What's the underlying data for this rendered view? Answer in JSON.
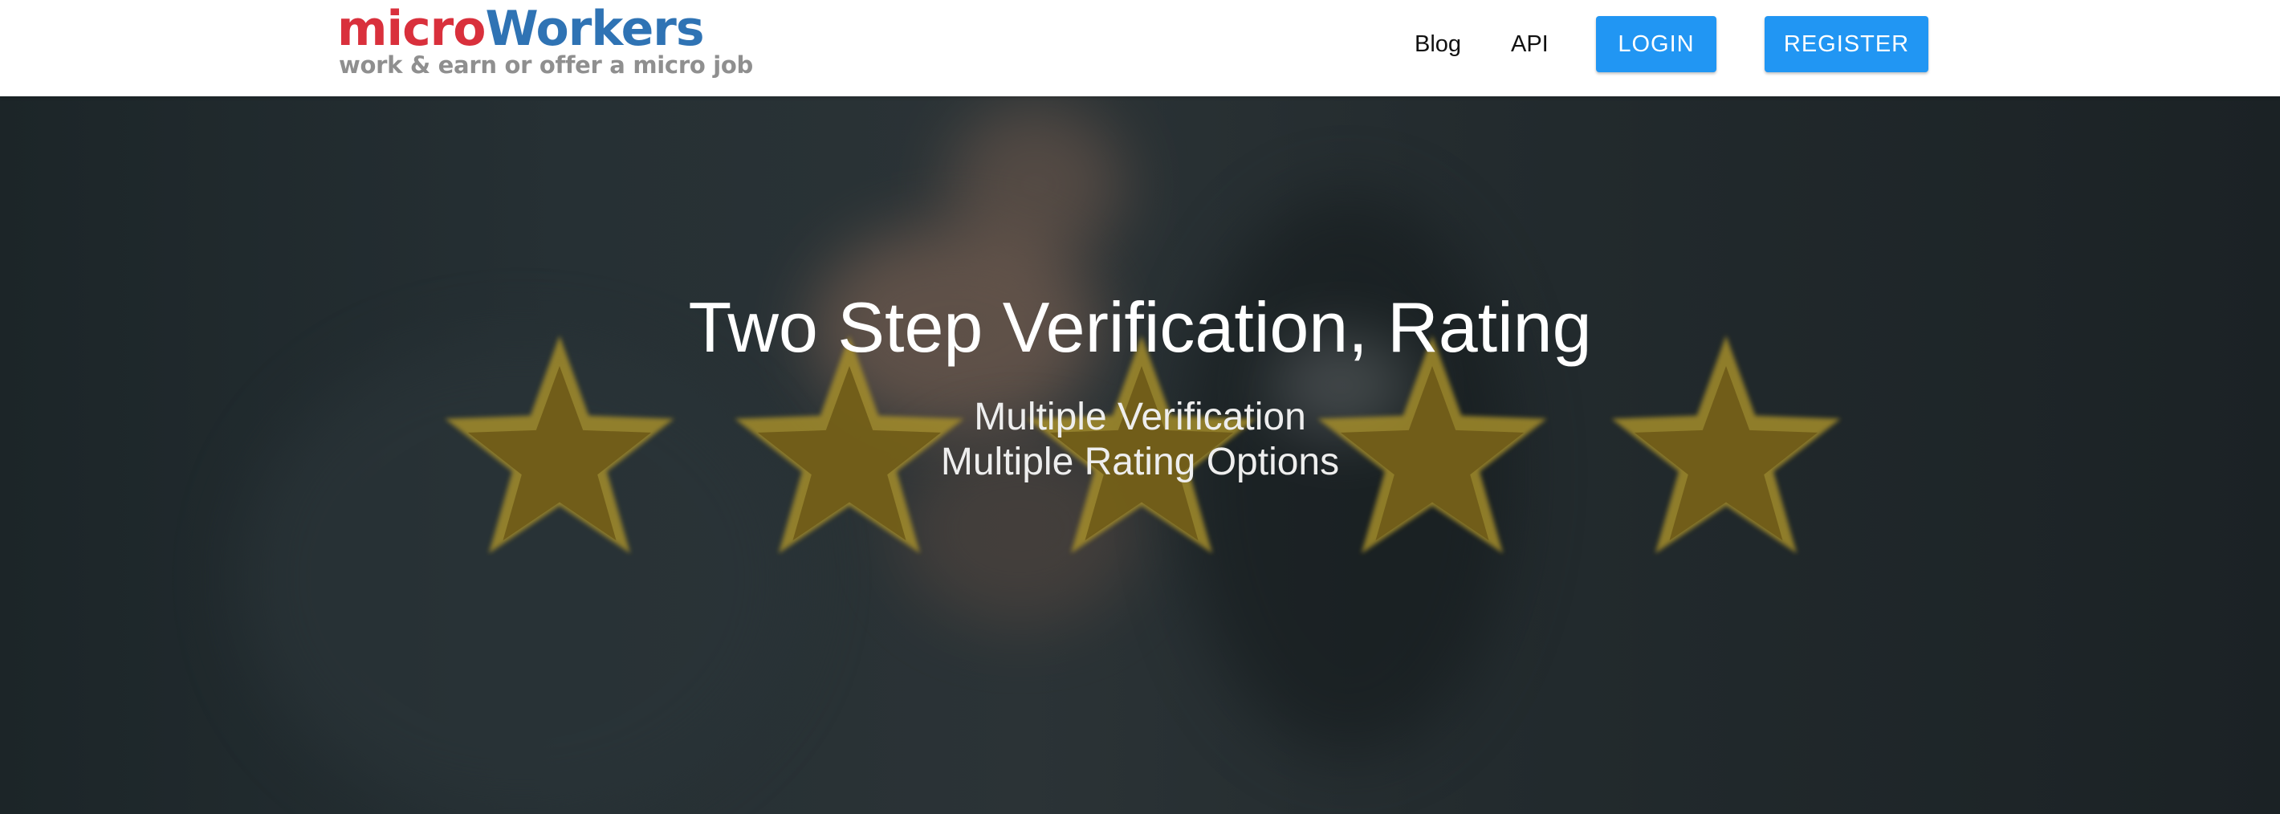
{
  "header": {
    "logo_part1": "micro",
    "logo_part2": "Workers",
    "logo_tagline": "work & earn or offer a micro job",
    "nav": {
      "blog": "Blog",
      "api": "API"
    },
    "login_label": "LOGIN",
    "register_label": "REGISTER"
  },
  "hero": {
    "title": "Two Step Verification, Rating",
    "subtitle_line1": "Multiple Verification",
    "subtitle_line2": "Multiple Rating Options",
    "stars": {
      "count": 5,
      "icon": "star-icon",
      "outer_color": "#a8902a",
      "inner_color": "#6e5a17"
    }
  },
  "colors": {
    "logo_red": "#d9303c",
    "logo_blue": "#2f73b4",
    "button_blue": "#2196f3",
    "hero_background": "#1b2326"
  }
}
